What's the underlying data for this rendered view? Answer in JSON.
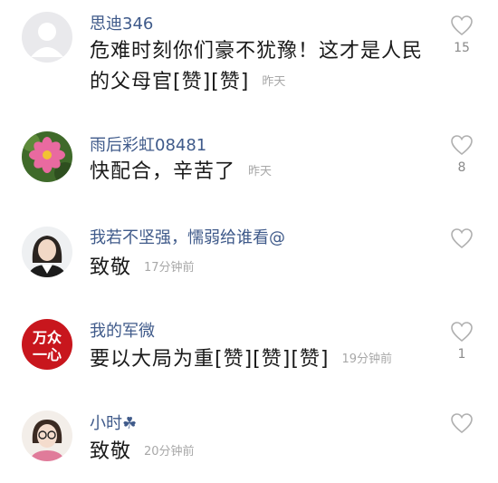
{
  "comments": [
    {
      "username": "思迪346",
      "text": "危难时刻你们豪不犹豫！这才是人民的父母官[赞][赞]",
      "time": "昨天",
      "likes": "15",
      "avatar_icon": "default-avatar-icon"
    },
    {
      "username": "雨后彩虹08481",
      "text": "快配合，辛苦了",
      "time": "昨天",
      "likes": "8",
      "avatar_icon": "pink-flower-avatar-icon"
    },
    {
      "username": "我若不坚强，懦弱给谁看@",
      "text": "致敬",
      "time": "17分钟前",
      "likes": "",
      "avatar_icon": "woman-portrait-avatar-icon"
    },
    {
      "username": "我的军微",
      "text": "要以大局为重[赞][赞][赞]",
      "time": "19分钟前",
      "likes": "1",
      "avatar_icon": "wanzhong-yixin-logo-avatar",
      "avatar_text_top": "万众",
      "avatar_text_bottom": "一心"
    },
    {
      "username": "小时☘",
      "text": "致敬",
      "time": "20分钟前",
      "likes": "",
      "avatar_icon": "girl-glasses-avatar-icon"
    }
  ]
}
